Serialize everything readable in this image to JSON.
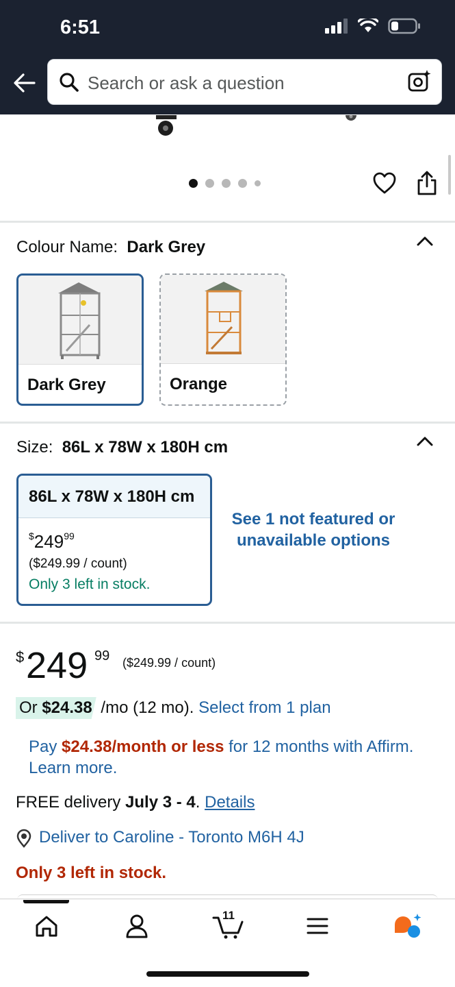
{
  "status_bar": {
    "time": "6:51"
  },
  "search": {
    "placeholder": "Search or ask a question"
  },
  "carousel": {
    "total": 5,
    "active": 0
  },
  "colour": {
    "label": "Colour Name:",
    "selected": "Dark Grey",
    "options": [
      {
        "name": "Dark Grey",
        "selected": true
      },
      {
        "name": "Orange",
        "selected": false
      }
    ]
  },
  "size": {
    "label": "Size:",
    "selected": "86L x 78W x 180H cm",
    "option": {
      "name": "86L x 78W x 180H cm",
      "price_symbol": "$",
      "price_whole": "249",
      "price_fraction": "99",
      "per_count": "($249.99 / count)",
      "stock": "Only 3 left in stock."
    },
    "see_more": "See 1 not featured or unavailable options"
  },
  "price": {
    "symbol": "$",
    "whole": "249",
    "fraction": "99",
    "per_count": "($249.99 / count)"
  },
  "monthly": {
    "prefix": "Or ",
    "amount": "$24.38",
    "suffix": " /mo (12 mo). ",
    "link": "Select from 1 plan"
  },
  "affirm": {
    "pre": "Pay ",
    "highlight": "$24.38/month or less",
    "post": " for 12 months with Affirm. Learn more."
  },
  "delivery": {
    "pre": "FREE delivery ",
    "dates": "July 3 - 4",
    "sep": ". ",
    "link": "Details"
  },
  "deliver_to": "Deliver to Caroline - Toronto M6H 4J",
  "stock_warning": "Only 3 left in stock.",
  "bottom_nav": {
    "items": [
      "home-icon",
      "account-icon",
      "cart-icon",
      "menu-icon",
      "rufus-icon"
    ],
    "cart_count": "11"
  },
  "colors": {
    "header_bg": "#1b2230",
    "link": "#2162a1",
    "deal_red": "#b12704",
    "stock_green": "#067d62",
    "selected_border": "#2a5d93"
  }
}
